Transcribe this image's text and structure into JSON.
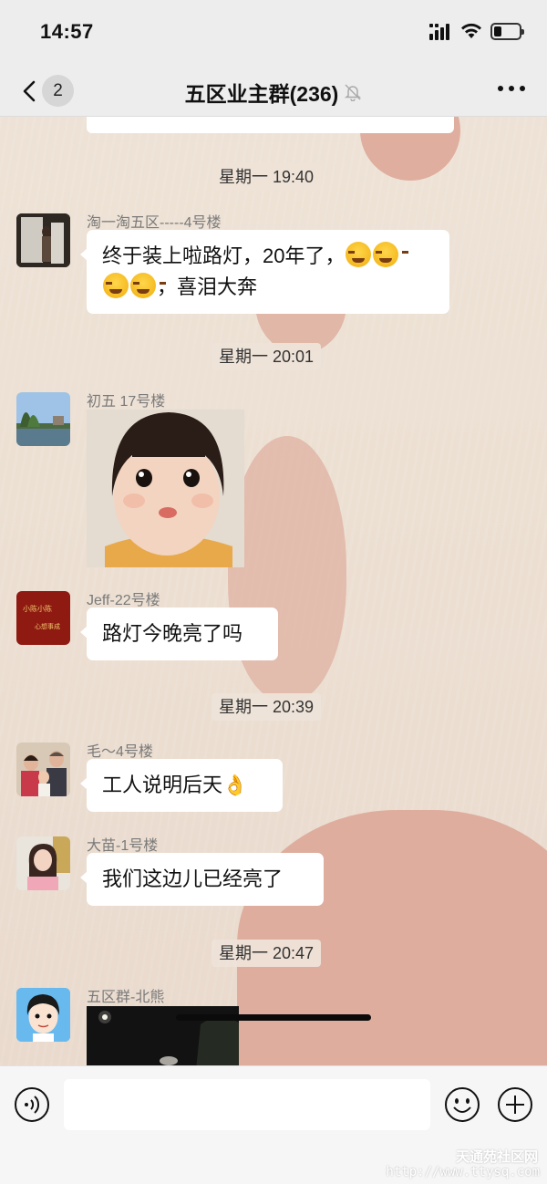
{
  "status_bar": {
    "time": "14:57",
    "battery_level": 0.3
  },
  "nav": {
    "back_badge": "2",
    "title": "五区业主群(236)",
    "muted": true
  },
  "messages": [
    {
      "type": "timestamp",
      "text": "星期一 19:40"
    },
    {
      "type": "text",
      "sender": "淘一淘五区-----4号楼",
      "line1": "终于装上啦路灯，20年了，",
      "line2": "，喜泪大奔"
    },
    {
      "type": "timestamp",
      "text": "星期一 20:01"
    },
    {
      "type": "image",
      "sender": "初五  17号楼"
    },
    {
      "type": "text",
      "sender": "Jeff-22号楼",
      "text": "路灯今晚亮了吗"
    },
    {
      "type": "timestamp",
      "text": "星期一 20:39"
    },
    {
      "type": "text",
      "sender": "毛～4号楼",
      "text": "工人说明后天"
    },
    {
      "type": "text",
      "sender": "大苗-1号楼",
      "text": "我们这边儿已经亮了"
    },
    {
      "type": "timestamp",
      "text": "星期一 20:47"
    },
    {
      "type": "image",
      "sender": "五区群-北熊"
    }
  ],
  "avatars": {
    "jeff_text_1": "小陈小陈",
    "jeff_text_2": "心想事成"
  },
  "input": {
    "value": ""
  },
  "watermark": {
    "title": "天通苑社区网",
    "url": "http://www.ttysq.com"
  },
  "icons": {
    "back": "chevron-left-icon",
    "mute": "bell-slash-icon",
    "more": "ellipsis-icon",
    "voice": "voice-icon",
    "emoji": "smiley-icon",
    "plus": "plus-icon"
  },
  "colors": {
    "bar_bg": "#ededed",
    "bubble_bg": "#ffffff",
    "chat_bg": "#ede0d4",
    "heart": "#dca594"
  }
}
